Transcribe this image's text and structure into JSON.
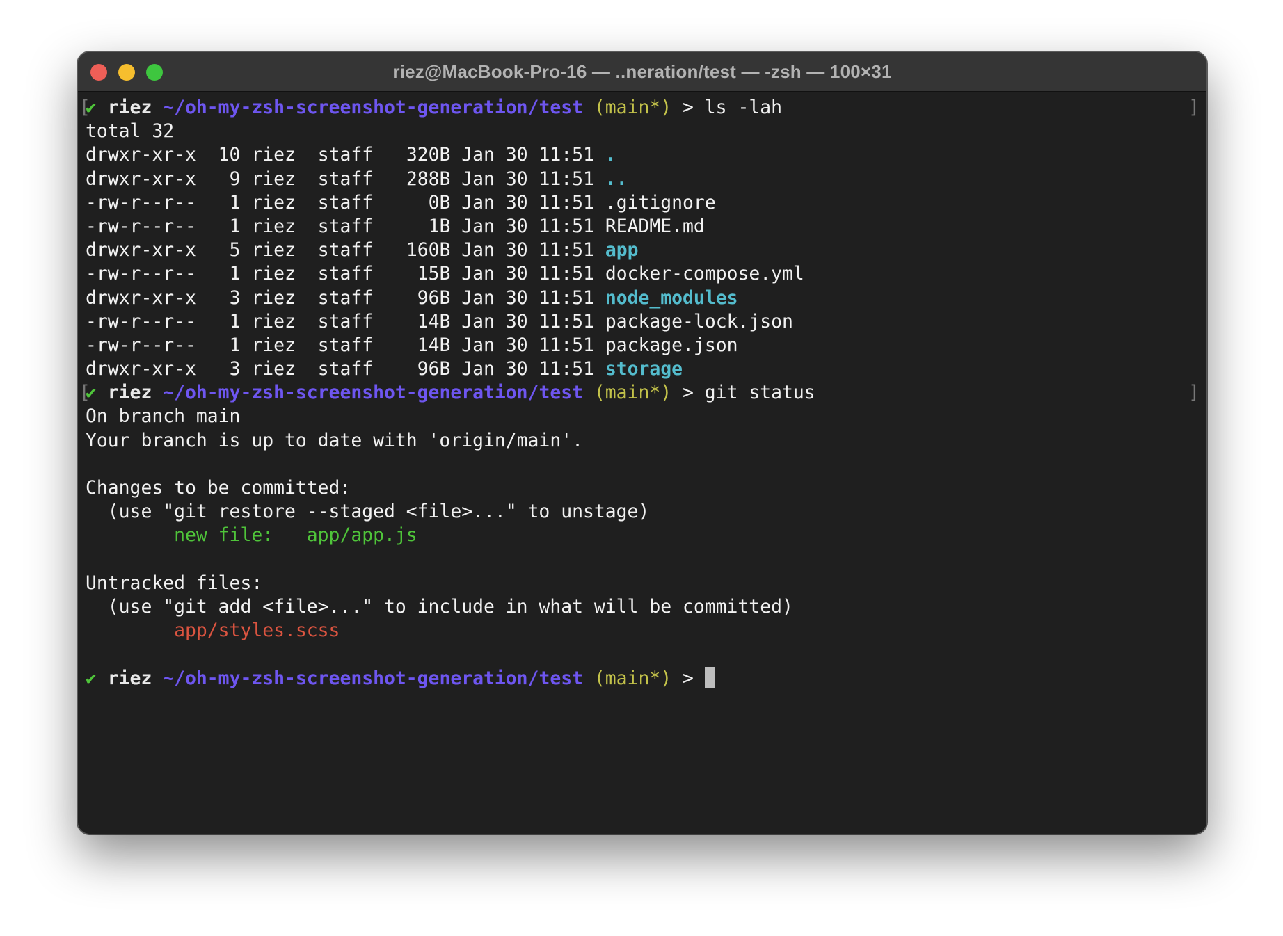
{
  "window": {
    "title": "riez@MacBook-Pro-16 — ..neration/test — -zsh — 100×31"
  },
  "prompt": {
    "check": "✔",
    "user": "riez",
    "path": "~/oh-my-zsh-screenshot-generation/test",
    "git": "(main*)",
    "arrow": ">"
  },
  "commands": {
    "ls": "ls -lah",
    "git_status": "git status"
  },
  "ls_output": {
    "total": "total 32",
    "rows": [
      {
        "perms": "drwxr-xr-x",
        "links": "10",
        "owner": "riez",
        "group": "staff",
        "size": "320B",
        "date": "Jan 30 11:51",
        "name": "."
      },
      {
        "perms": "drwxr-xr-x",
        "links": "9",
        "owner": "riez",
        "group": "staff",
        "size": "288B",
        "date": "Jan 30 11:51",
        "name": ".."
      },
      {
        "perms": "-rw-r--r--",
        "links": "1",
        "owner": "riez",
        "group": "staff",
        "size": "0B",
        "date": "Jan 30 11:51",
        "name": ".gitignore"
      },
      {
        "perms": "-rw-r--r--",
        "links": "1",
        "owner": "riez",
        "group": "staff",
        "size": "1B",
        "date": "Jan 30 11:51",
        "name": "README.md"
      },
      {
        "perms": "drwxr-xr-x",
        "links": "5",
        "owner": "riez",
        "group": "staff",
        "size": "160B",
        "date": "Jan 30 11:51",
        "name": "app"
      },
      {
        "perms": "-rw-r--r--",
        "links": "1",
        "owner": "riez",
        "group": "staff",
        "size": "15B",
        "date": "Jan 30 11:51",
        "name": "docker-compose.yml"
      },
      {
        "perms": "drwxr-xr-x",
        "links": "3",
        "owner": "riez",
        "group": "staff",
        "size": "96B",
        "date": "Jan 30 11:51",
        "name": "node_modules"
      },
      {
        "perms": "-rw-r--r--",
        "links": "1",
        "owner": "riez",
        "group": "staff",
        "size": "14B",
        "date": "Jan 30 11:51",
        "name": "package-lock.json"
      },
      {
        "perms": "-rw-r--r--",
        "links": "1",
        "owner": "riez",
        "group": "staff",
        "size": "14B",
        "date": "Jan 30 11:51",
        "name": "package.json"
      },
      {
        "perms": "drwxr-xr-x",
        "links": "3",
        "owner": "riez",
        "group": "staff",
        "size": "96B",
        "date": "Jan 30 11:51",
        "name": "storage"
      }
    ]
  },
  "git_output": {
    "branch_line": "On branch main",
    "uptodate_line": "Your branch is up to date with 'origin/main'.",
    "staged_header": "Changes to be committed:",
    "staged_hint": "  (use \"git restore --staged <file>...\" to unstage)",
    "staged_label": "new file:",
    "staged_file": "app/app.js",
    "untracked_header": "Untracked files:",
    "untracked_hint": "  (use \"git add <file>...\" to include in what will be committed)",
    "untracked_file": "app/styles.scss"
  },
  "colors": {
    "check": "#4fc43a",
    "path": "#6e56f0",
    "git_branch": "#c3c24a",
    "directory": "#54bccd",
    "staged": "#4fc43a",
    "untracked": "#db5440",
    "background": "#1f1f1f"
  }
}
